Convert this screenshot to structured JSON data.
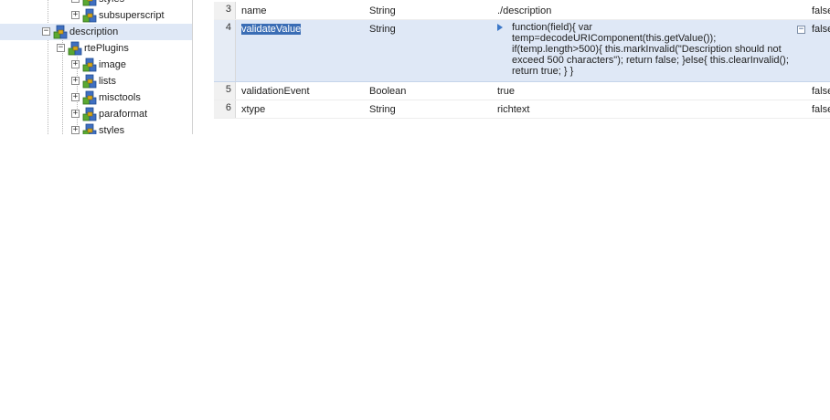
{
  "tree": {
    "nodes": [
      {
        "label": "styles",
        "expanded": false,
        "selected": false
      },
      {
        "label": "subsuperscript",
        "expanded": false,
        "selected": false
      },
      {
        "label": "description",
        "expanded": true,
        "selected": true
      },
      {
        "label": "rtePlugins",
        "expanded": true,
        "selected": false
      },
      {
        "label": "image",
        "expanded": false,
        "selected": false
      },
      {
        "label": "lists",
        "expanded": false,
        "selected": false
      },
      {
        "label": "misctools",
        "expanded": false,
        "selected": false
      },
      {
        "label": "paraformat",
        "expanded": false,
        "selected": false
      },
      {
        "label": "styles",
        "expanded": false,
        "selected": false
      }
    ],
    "expand_glyph": "+",
    "collapse_glyph": "−",
    "node_icon": "node-cubes-icon"
  },
  "grid": {
    "rows": [
      {
        "num": "3",
        "name": "name",
        "type": "String",
        "value": "./description",
        "protected": "false"
      },
      {
        "num": "4",
        "name": "validateValue",
        "type": "String",
        "value": "function(field){ var temp=decodeURIComponent(this.getValue()); if(temp.length>500){ this.markInvalid(\"Description should not exceed 500 characters\"); return false; }else{ this.clearInvalid(); return true; } }",
        "protected": "false",
        "selected": true,
        "expand_icon": "expand-arrow-icon",
        "collapse_glyph": "−"
      },
      {
        "num": "5",
        "name": "validationEvent",
        "type": "Boolean",
        "value": "true",
        "protected": "false"
      },
      {
        "num": "6",
        "name": "xtype",
        "type": "String",
        "value": "richtext",
        "protected": "false"
      }
    ]
  },
  "colors": {
    "selection": "#dfe8f6",
    "name_highlight": "#3a6db5",
    "icon_blue": "#3f6fc1",
    "icon_green": "#5aa831",
    "icon_gold": "#d9a81a"
  }
}
